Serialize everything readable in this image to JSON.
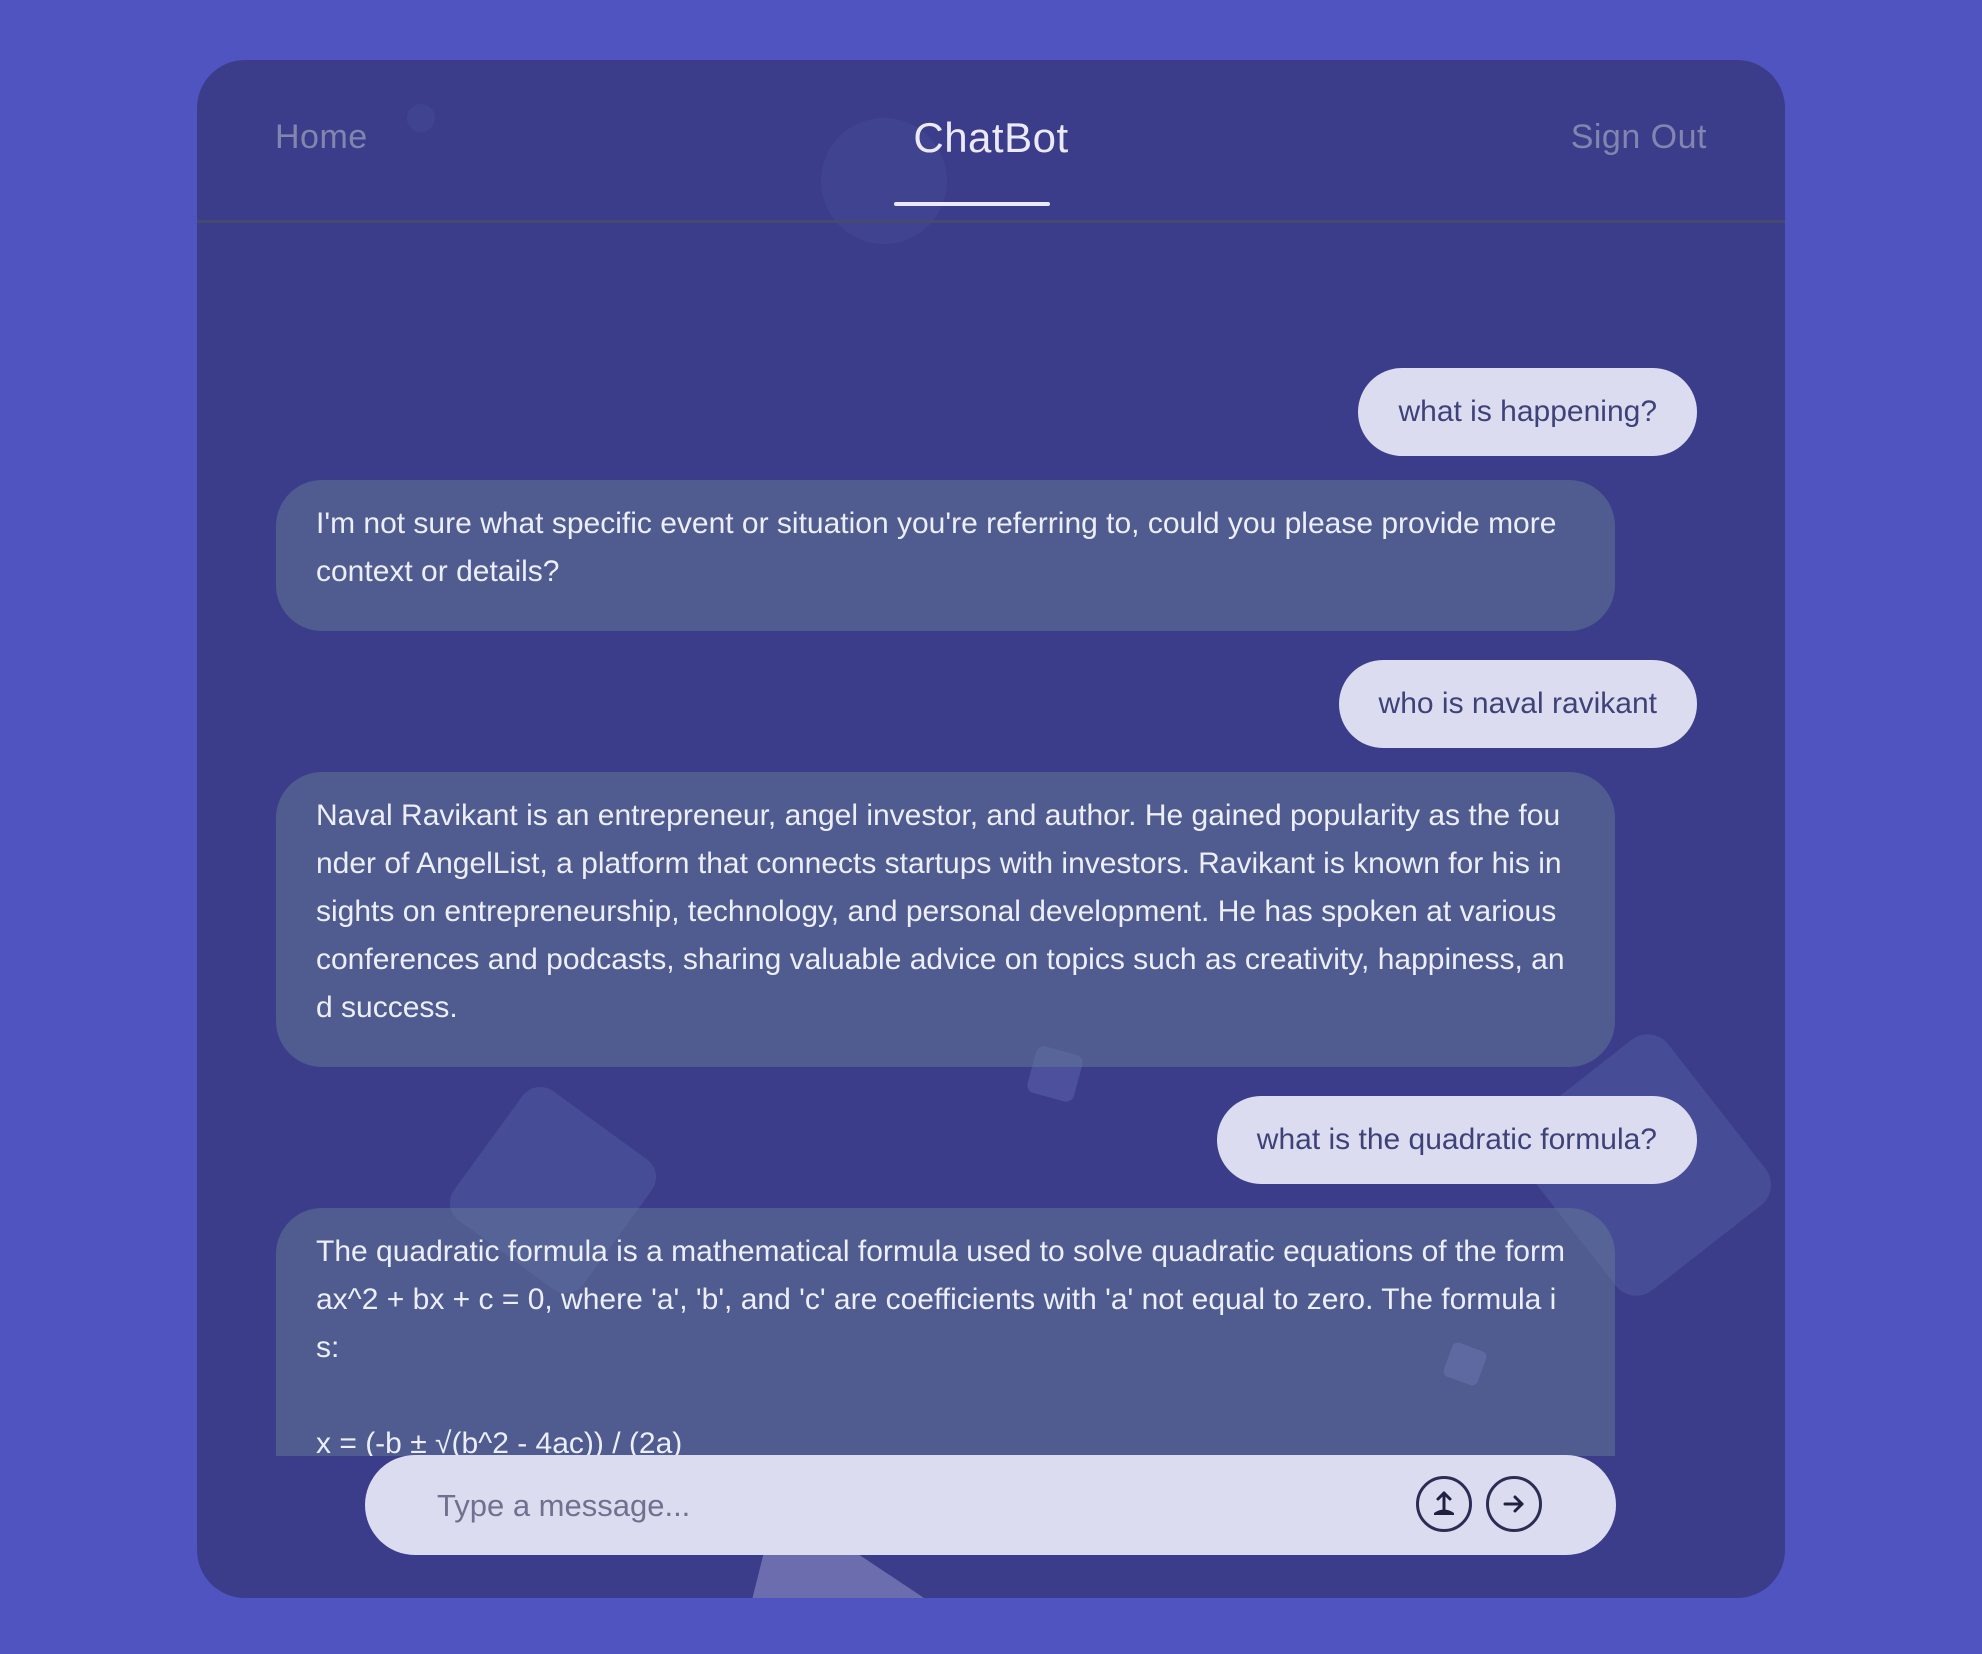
{
  "nav": {
    "home": "Home",
    "title": "ChatBot",
    "sign_out": "Sign Out"
  },
  "messages": [
    {
      "role": "user",
      "text": "what is happening?"
    },
    {
      "role": "bot",
      "text": "I'm not sure what specific event or situation you're referring to, could you please provide more context or details?"
    },
    {
      "role": "user",
      "text": "who is naval ravikant"
    },
    {
      "role": "bot",
      "text": "Naval Ravikant is an entrepreneur, angel investor, and author. He gained popularity as the founder of AngelList, a platform that connects startups with investors. Ravikant is known for his insights on entrepreneurship, technology, and personal development. He has spoken at various conferences and podcasts, sharing valuable advice on topics such as creativity, happiness, and success."
    },
    {
      "role": "user",
      "text": "what is the quadratic formula?"
    },
    {
      "role": "bot",
      "text": "The quadratic formula is a mathematical formula used to solve quadratic equations of the form ax^2 + bx + c = 0, where 'a', 'b', and 'c' are coefficients with 'a' not equal to zero. The formula is:\n\nx = (-b ± √(b^2 - 4ac)) / (2a)"
    }
  ],
  "composer": {
    "placeholder": "Type a message...",
    "upload_icon": "upload-icon",
    "send_icon": "arrow-right-icon"
  },
  "colors": {
    "background": "#5054c1",
    "card": "#3b3d8b",
    "user_bubble": "#dcdcf1",
    "bot_bubble": "#4f5b88"
  }
}
